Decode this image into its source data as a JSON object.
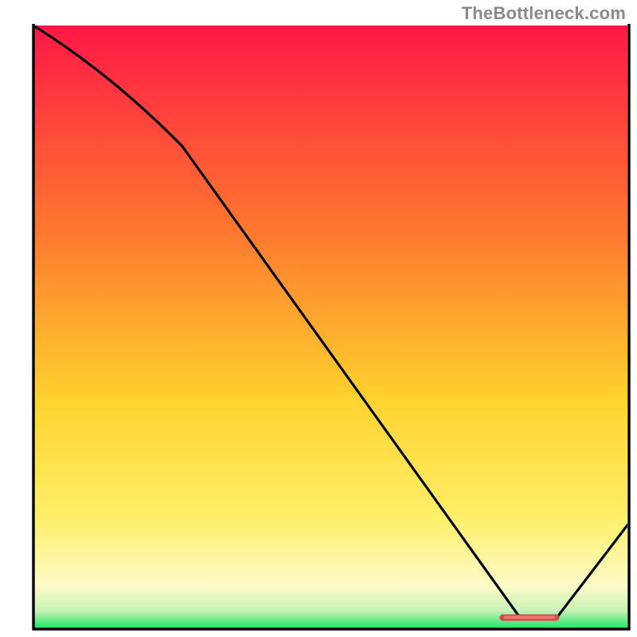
{
  "watermark": {
    "text": "TheBottleneck.com"
  },
  "colors": {
    "top": "#ff1846",
    "upper_mid": "#ff7a2e",
    "mid": "#ffd22e",
    "lower_mid": "#fff06a",
    "pale": "#fdfac8",
    "green": "#27e56a",
    "frame": "#000000",
    "curve": "#000000",
    "accent": "#f05a5a",
    "accent_core": "#d94747"
  },
  "chart_data": {
    "type": "line",
    "title": "",
    "xlabel": "",
    "ylabel": "",
    "xlim": [
      0,
      100
    ],
    "ylim": [
      0,
      100
    ],
    "x": [
      0,
      25,
      82,
      88,
      100
    ],
    "values": [
      100,
      80,
      1.5,
      1.5,
      17
    ],
    "accent_segment": {
      "x0": 79,
      "x1": 88,
      "y": 1.5
    },
    "notes": "Curve reaches near-zero at approximately x=82–88, then rises again."
  }
}
